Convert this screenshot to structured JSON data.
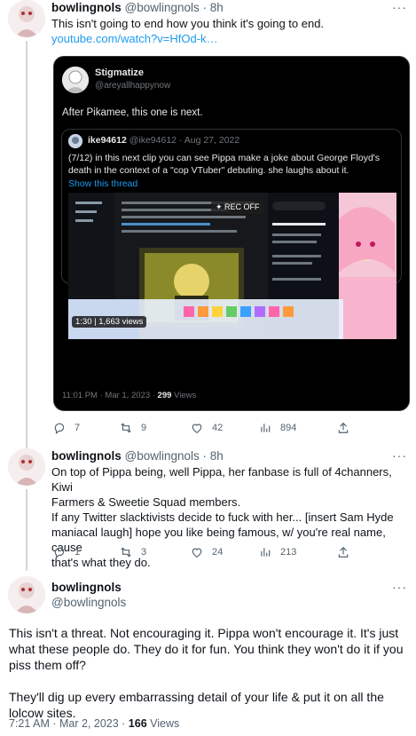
{
  "tweet1": {
    "name": "bowlingnols",
    "handle": "@bowlingnols",
    "separator": "·",
    "time": "8h",
    "text": "This isn't going to end how you think it's going to end.",
    "link": "youtube.com/watch?v=HfOd-k…",
    "quoted": {
      "name": "Stigmatize",
      "handle": "@areyallhappynow",
      "text": "After Pikamee, this one is next.",
      "nested": {
        "name": "ike94612",
        "handle": "@ike94612",
        "date": "· Aug 27, 2022",
        "text": "(7/12) in this next clip you can see Pippa make a joke about George Floyd's death in the context of a \"cop VTuber\" debuting. she laughs about it.",
        "show_thread": "Show this thread"
      },
      "rec_badge": "✦ REC OFF",
      "video_views": "1:30 | 1,663 views",
      "footer_time": "11:01 PM · Mar 1, 2023 ·",
      "footer_views_count": "299",
      "footer_views_label": "Views"
    },
    "actions": {
      "replies": "7",
      "retweets": "9",
      "likes": "42",
      "views": "894"
    }
  },
  "tweet2": {
    "name": "bowlingnols",
    "handle": "@bowlingnols",
    "separator": "·",
    "time": "8h",
    "line1": "On top of Pippa being, well Pippa, her fanbase is full of 4channers, Kiwi",
    "line2": "Farmers & Sweetie Squad members.",
    "line3": "If any Twitter slacktivists decide to fuck with her... [insert Sam Hyde",
    "line4": "maniacal laugh] hope you like being famous, w/ you're real name, cause",
    "line5": "that's what they do.",
    "actions": {
      "replies": "1",
      "retweets": "3",
      "likes": "24",
      "views": "213"
    }
  },
  "tweet3": {
    "name": "bowlingnols",
    "handle": "@bowlingnols",
    "para1_line1": "This isn't a threat. Not encouraging it. Pippa won't encourage it. It's just",
    "para1_line2": "what these people do. They do it for fun. You think they won't do it if you",
    "para1_line3": "piss them off?",
    "para2_line1": "They'll dig up every embarrassing detail of your life & put it on all the",
    "para2_line2": "lolcow sites.",
    "meta_time": "7:21 AM · Mar 2, 2023 ·",
    "meta_views_count": "166",
    "meta_views_label": "Views"
  },
  "more_label": "···",
  "colors": {
    "accent": "#1d9bf0",
    "muted": "#536471",
    "border": "#eff3f4"
  }
}
